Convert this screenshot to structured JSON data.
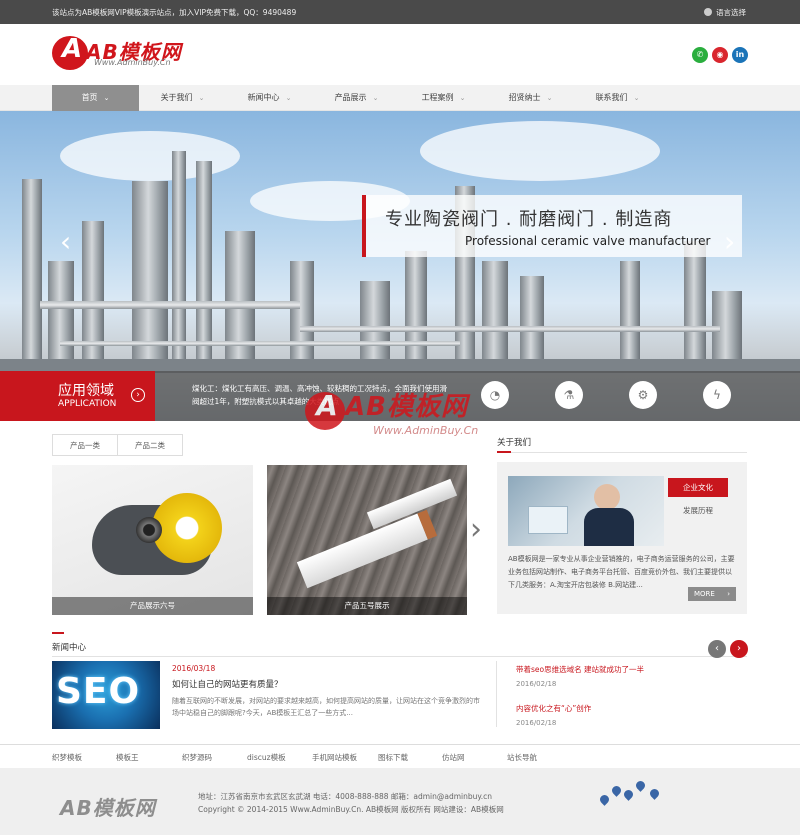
{
  "topbar": {
    "message": "该站点为AB模板网VIP模板演示站点，加入VIP免费下载，QQ：9490489",
    "language": "语言选择"
  },
  "header": {
    "logo_mark": "A",
    "logo_text": "AB模板网",
    "logo_url": "Www.AdminBuy.Cn",
    "social": [
      "wechat-icon",
      "weibo-icon",
      "linkedin-icon"
    ]
  },
  "nav": {
    "items": [
      {
        "label": "首页",
        "active": true
      },
      {
        "label": "关于我们"
      },
      {
        "label": "新闻中心"
      },
      {
        "label": "产品展示"
      },
      {
        "label": "工程案例"
      },
      {
        "label": "招贤纳士"
      },
      {
        "label": "联系我们"
      }
    ]
  },
  "banner": {
    "slogan_cn": "专业陶瓷阀门 . 耐磨阀门 . 制造商",
    "slogan_en": "Professional ceramic valve manufacturer",
    "prev": "‹",
    "next": "›",
    "application": {
      "title": "应用领域",
      "subtitle": "APPLICATION",
      "go": "›",
      "desc": "煤化工：煤化工有高压、调温、高冲蚀、较粘稠的工况特点，全面我们使用滑阀超过1年，附塑抗模式以其卓越的大类优点",
      "icons": [
        "drop-icon",
        "flask-icon",
        "gear-icon",
        "lightning-icon"
      ]
    }
  },
  "watermark": {
    "mark": "A",
    "text": "AB模板网",
    "url": "Www.AdminBuy.Cn"
  },
  "products": {
    "tabs": [
      "产品一类",
      "产品二类"
    ],
    "items": [
      {
        "caption": "产品展示六号"
      },
      {
        "caption": "产品五号展示"
      }
    ],
    "next": "›"
  },
  "about": {
    "title": "关于我们",
    "tabs": [
      "企业文化",
      "发展历程"
    ],
    "text": "AB模板网是一家专业从事企业营销推的，电子商务运营服务的公司，主要业务包括网站制作、电子商务平台托管、百度竞价外包、我们主要提供以下几类服务：A.淘宝开店包装修 B.网站建...",
    "more": "MORE",
    "more_arrow": "›"
  },
  "news": {
    "title": "新闻中心",
    "prev": "‹",
    "next": "›",
    "image_text": "SEO",
    "featured": {
      "date": "2016/03/18",
      "headline": "如何让自己的网站更有质量？",
      "summary": "随着互联网的不断发展，对网站的要求越来越高，如何提高网站的质量，让网站在这个竞争激烈的市场中站稳自己的脚跟呢?今天，AB模板王汇总了一些方式..."
    },
    "side": [
      {
        "title": "带着seo思维选域名 建站就成功了一半",
        "date": "2016/02/18"
      },
      {
        "title": "内容优化之有“心”创作",
        "date": "2016/02/18"
      }
    ]
  },
  "links": [
    "织梦模板",
    "模板王",
    "织梦源码",
    "discuz模板",
    "手机网站模板",
    "图标下载",
    "仿站网",
    "站长导航"
  ],
  "footer": {
    "logo": "AB模板网",
    "line1": "地址：江苏省南京市玄武区玄武湖    电话：4008-888-888    邮箱：admin@adminbuy.cn",
    "line2": "Copyright © 2014-2015 Www.AdminBuy.Cn. AB模板网 版权所有    网站建设：AB模板网"
  },
  "colors": {
    "accent": "#c8161d",
    "topbar": "#4a4a4a",
    "nav_active": "#8f8f8f",
    "footer": "#efefef"
  }
}
